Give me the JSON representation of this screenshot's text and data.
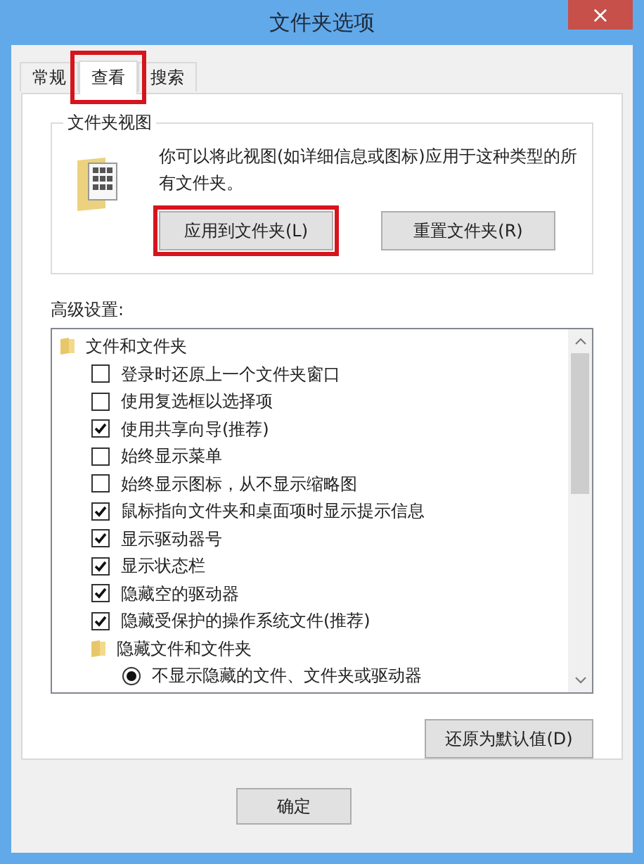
{
  "window": {
    "title": "文件夹选项",
    "close": "×"
  },
  "tabs": [
    {
      "label": "常规",
      "selected": false,
      "highlighted": false
    },
    {
      "label": "查看",
      "selected": true,
      "highlighted": true
    },
    {
      "label": "搜索",
      "selected": false,
      "highlighted": false
    }
  ],
  "folder_views": {
    "title": "文件夹视图",
    "description": "你可以将此视图(如详细信息或图标)应用于这种类型的所有文件夹。",
    "buttons": [
      {
        "label": "应用到文件夹(L)",
        "highlighted": true
      },
      {
        "label": "重置文件夹(R)",
        "highlighted": false
      }
    ]
  },
  "advanced": {
    "label": "高级设置:",
    "items": [
      {
        "kind": "folder",
        "label": "文件和文件夹",
        "children": [
          {
            "kind": "checkbox",
            "label": "登录时还原上一个文件夹窗口",
            "checked": false
          },
          {
            "kind": "checkbox",
            "label": "使用复选框以选择项",
            "checked": false
          },
          {
            "kind": "checkbox",
            "label": "使用共享向导(推荐)",
            "checked": true
          },
          {
            "kind": "checkbox",
            "label": "始终显示菜单",
            "checked": false
          },
          {
            "kind": "checkbox",
            "label": "始终显示图标，从不显示缩略图",
            "checked": false
          },
          {
            "kind": "checkbox",
            "label": "鼠标指向文件夹和桌面项时显示提示信息",
            "checked": true
          },
          {
            "kind": "checkbox",
            "label": "显示驱动器号",
            "checked": true
          },
          {
            "kind": "checkbox",
            "label": "显示状态栏",
            "checked": true
          },
          {
            "kind": "checkbox",
            "label": "隐藏空的驱动器",
            "checked": true
          },
          {
            "kind": "checkbox",
            "label": "隐藏受保护的操作系统文件(推荐)",
            "checked": true
          },
          {
            "kind": "folder",
            "label": "隐藏文件和文件夹",
            "children": [
              {
                "kind": "radio",
                "label": "不显示隐藏的文件、文件夹或驱动器",
                "selected": true
              }
            ]
          }
        ]
      }
    ]
  },
  "restore_button": "还原为默认值(D)",
  "footer_buttons": [
    "确定"
  ]
}
